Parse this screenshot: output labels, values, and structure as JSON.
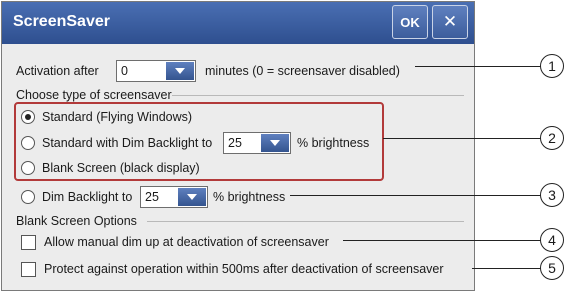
{
  "window": {
    "title": "ScreenSaver",
    "ok_label": "OK",
    "close_label": "✕"
  },
  "activation": {
    "label": "Activation after",
    "value": "0",
    "suffix": "minutes (0 = screensaver disabled)"
  },
  "screensaver_type": {
    "heading": "Choose type of screensaver",
    "options": [
      {
        "label": "Standard (Flying Windows)",
        "selected": true
      },
      {
        "label": "Standard with Dim Backlight to",
        "selected": false,
        "value": "25",
        "suffix": "% brightness"
      },
      {
        "label": "Blank Screen (black display)",
        "selected": false
      }
    ],
    "dim_option": {
      "label": "Dim Backlight to",
      "selected": false,
      "value": "25",
      "suffix": "% brightness"
    }
  },
  "blank_screen_options": {
    "heading": "Blank Screen Options",
    "checkboxes": [
      {
        "label": "Allow manual dim up at deactivation of screensaver",
        "checked": false
      },
      {
        "label": "Protect against operation within 500ms after deactivation of screensaver",
        "checked": false
      }
    ]
  },
  "callouts": [
    "1",
    "2",
    "3",
    "4",
    "5"
  ],
  "colors": {
    "titlebar": "#3a5ea3",
    "highlight_box": "#b23a3a"
  }
}
